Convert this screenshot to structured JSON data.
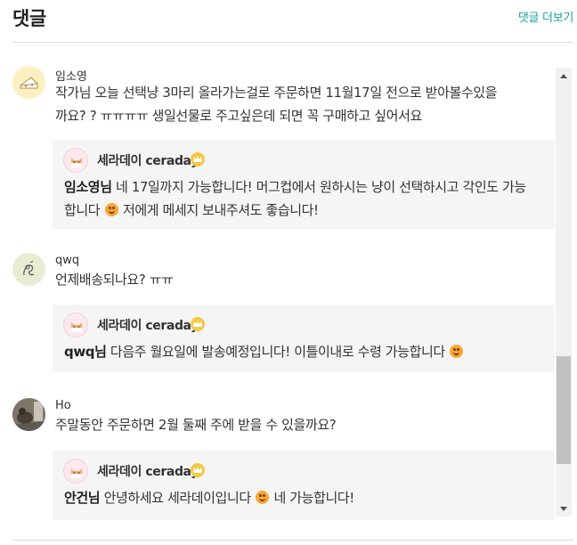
{
  "header": {
    "title": "댓글",
    "more_label": "댓글 더보기"
  },
  "colors": {
    "accent": "#1aa0a6",
    "reply_bg": "#f5f5f5",
    "crown": "#f5c842"
  },
  "comments": [
    {
      "user": "임소영",
      "text_line1": "작가님 오늘 선택냥 3마리 올라가는걸로 주문하면 11월17일 전으로 받아볼수있을",
      "text_line2": "까요? ? ㅠㅠㅠㅠ 생일선물로 주고싶은데 되면 꼭 구매하고 싶어서요",
      "reply": {
        "author": "세라데이 ceraday",
        "mention": "임소영님",
        "line1": " 네 17일까지 가능합니다! 머그컵에서 원하시는 냥이 선택하시고 각인도 가능",
        "line2a": "합니다 ",
        "line2b": " 저에게 메세지 보내주셔도 좋습니다!"
      }
    },
    {
      "user": "qwq",
      "text_line1": "언제배송되나요? ㅠㅠ",
      "reply": {
        "author": "세라데이 ceraday",
        "mention": "qwq님",
        "line1": " 다음주 월요일에 발송예정입니다! 이틀이내로 수령 가능합니다"
      }
    },
    {
      "user": "Ho",
      "text_line1": "주말동안 주문하면 2월 둘째 주에 받을 수 있을까요?",
      "reply": {
        "author": "세라데이 ceraday",
        "mention": "안건님",
        "line1": " 안녕하세요 세라데이입니다 ",
        "line1b": " 네 가능합니다!"
      }
    }
  ],
  "icons": {
    "avatar1": "cheese-avatar-icon",
    "avatar2": "sketch-avatar-icon",
    "avatar3": "photo-avatar",
    "shop": "cat-shop-avatar-icon",
    "crown": "crown-badge-icon",
    "emoji": "smile-emoji-icon"
  },
  "scroll": {
    "thumb_position_fraction": 0.76
  }
}
